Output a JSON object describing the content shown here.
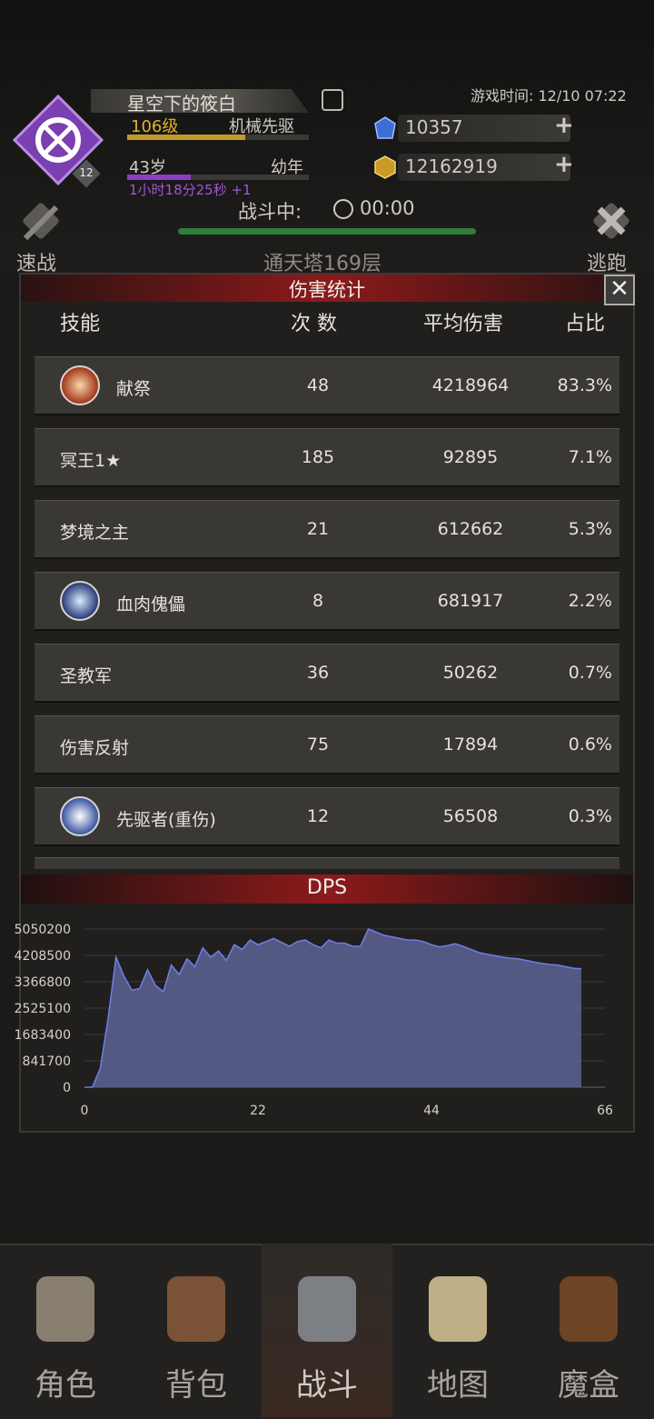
{
  "player": {
    "name": "星空下的筱白",
    "level": "106级",
    "class": "机械先驱",
    "age": "43岁",
    "stage": "幼年",
    "lifetime": "1小时18分25秒 +1",
    "badge": "12"
  },
  "game_time": "游戏时间: 12/10 07:22",
  "resources": [
    {
      "name": "gem-blue",
      "value": "10357"
    },
    {
      "name": "gem-gold",
      "value": "12162919"
    }
  ],
  "battle": {
    "status": "战斗中:",
    "timer": "00:00",
    "floor": "通天塔169层",
    "quick_fight": "速战",
    "escape": "逃跑"
  },
  "damage_stats": {
    "title": "伤害统计",
    "close": "✕",
    "headers": [
      "技能",
      "次 数",
      "平均伤害",
      "占比"
    ],
    "rows": [
      {
        "skill": "献祭",
        "count": "48",
        "avg": "4218964",
        "pct": "83.3%",
        "icon": "sacrifice-icon"
      },
      {
        "skill": "冥王1★",
        "count": "185",
        "avg": "92895",
        "pct": "7.1%",
        "icon": ""
      },
      {
        "skill": "梦境之主",
        "count": "21",
        "avg": "612662",
        "pct": "5.3%",
        "icon": ""
      },
      {
        "skill": "血肉傀儡",
        "count": "8",
        "avg": "681917",
        "pct": "2.2%",
        "icon": "flesh-puppet-icon"
      },
      {
        "skill": "圣教军",
        "count": "36",
        "avg": "50262",
        "pct": "0.7%",
        "icon": ""
      },
      {
        "skill": "伤害反射",
        "count": "75",
        "avg": "17894",
        "pct": "0.6%",
        "icon": ""
      },
      {
        "skill": "先驱者(重伤)",
        "count": "12",
        "avg": "56508",
        "pct": "0.3%",
        "icon": "pioneer-icon"
      }
    ]
  },
  "chart_data": {
    "type": "area",
    "title": "DPS",
    "xlabel": "",
    "ylabel": "",
    "xlim": [
      0,
      66
    ],
    "ylim": [
      0,
      5050200
    ],
    "x_ticks": [
      0,
      22,
      44,
      66
    ],
    "y_ticks": [
      0,
      841700,
      1683400,
      2525100,
      3366800,
      4208500,
      5050200
    ],
    "series": [
      {
        "x": [
          0,
          1,
          2,
          3,
          4,
          5,
          6,
          7,
          8,
          9,
          10,
          11,
          12,
          13,
          14,
          15,
          16,
          17,
          18,
          19,
          20,
          21,
          22,
          23,
          24,
          25,
          26,
          27,
          28,
          29,
          30,
          31,
          32,
          33,
          34,
          35,
          36,
          37,
          38,
          39,
          40,
          41,
          42,
          43,
          44,
          45,
          46,
          47,
          48,
          49,
          50,
          51,
          52,
          53,
          54,
          55,
          56,
          57,
          58,
          59,
          60,
          61,
          62,
          63
        ],
        "y": [
          0,
          0,
          600000,
          2200000,
          4150000,
          3550000,
          3100000,
          3150000,
          3750000,
          3250000,
          3050000,
          3900000,
          3600000,
          4100000,
          3850000,
          4450000,
          4150000,
          4350000,
          4050000,
          4550000,
          4400000,
          4700000,
          4550000,
          4650000,
          4750000,
          4620000,
          4500000,
          4650000,
          4700000,
          4550000,
          4450000,
          4700000,
          4600000,
          4600000,
          4500000,
          4500000,
          5050000,
          4950000,
          4850000,
          4800000,
          4750000,
          4700000,
          4700000,
          4650000,
          4550000,
          4480000,
          4520000,
          4580000,
          4500000,
          4400000,
          4300000,
          4250000,
          4200000,
          4150000,
          4120000,
          4100000,
          4050000,
          4000000,
          3950000,
          3920000,
          3900000,
          3850000,
          3800000,
          3780000
        ],
        "color": "#5a5f90"
      }
    ],
    "grid": true
  },
  "bottom_nav": [
    {
      "label": "角色",
      "icon": "helmet-icon"
    },
    {
      "label": "背包",
      "icon": "backpack-icon"
    },
    {
      "label": "战斗",
      "icon": "sword-shield-icon"
    },
    {
      "label": "地图",
      "icon": "scroll-map-icon"
    },
    {
      "label": "魔盒",
      "icon": "magic-box-icon"
    }
  ]
}
